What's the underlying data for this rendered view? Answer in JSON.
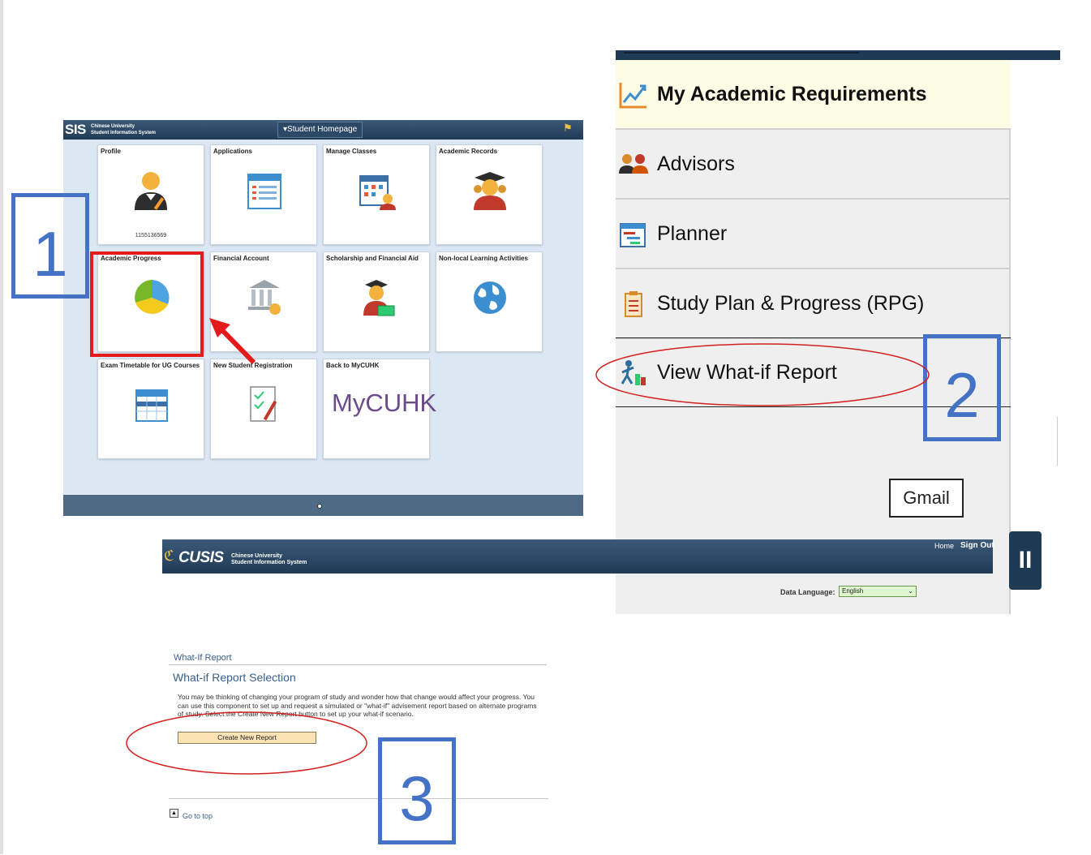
{
  "panel1": {
    "logo": "SIS",
    "logo_sub": "Chinese University\nStudent Information System",
    "nav_label": "Student Homepage",
    "tiles": [
      {
        "title": "Profile",
        "icon": "person-icon",
        "extra": "1155136569"
      },
      {
        "title": "Applications",
        "icon": "form-icon"
      },
      {
        "title": "Manage Classes",
        "icon": "calendar-student-icon"
      },
      {
        "title": "Academic Records",
        "icon": "graduate-icon"
      },
      {
        "title": "Academic Progress",
        "icon": "pie-chart-icon"
      },
      {
        "title": "Financial Account",
        "icon": "bank-icon"
      },
      {
        "title": "Scholarship and Financial Aid",
        "icon": "scholarship-icon"
      },
      {
        "title": "Non-local Learning Activities",
        "icon": "globe-icon"
      },
      {
        "title": "Exam Timetable for UG Courses",
        "icon": "calendar-icon"
      },
      {
        "title": "New Student Registration",
        "icon": "registration-icon"
      },
      {
        "title": "Back to MyCUHK",
        "icon": "mycuhk-logo"
      }
    ],
    "mycuhk_logo": "MyCUHK"
  },
  "steps": {
    "one": "1",
    "two": "2",
    "three": "3"
  },
  "panel2": {
    "menu": [
      {
        "label": "My Academic Requirements",
        "icon": "trend-chart-icon",
        "active": true
      },
      {
        "label": "Advisors",
        "icon": "people-icon"
      },
      {
        "label": "Planner",
        "icon": "planner-icon"
      },
      {
        "label": "Study Plan & Progress (RPG)",
        "icon": "clipboard-icon"
      },
      {
        "label": "View What-if Report",
        "icon": "whatif-icon"
      }
    ],
    "gmail": "Gmail"
  },
  "panel3": {
    "logo": "CUSIS",
    "logo_sub": "Chinese University\nStudent Information System",
    "home": "Home",
    "sign_out": "Sign Out",
    "data_language_label": "Data Language:",
    "data_language_value": "English",
    "breadcrumb": "What-If Report",
    "title": "What-if Report Selection",
    "description": "You may be thinking of changing your program of study and wonder how that change would affect your progress. You can use this component to set up and request a simulated or \"what-if\" advisement report based on alternate programs of study. Select the Create New Report button to set up your what-if scenario.",
    "create_button": "Create New Report",
    "go_to_top": "Go to top"
  },
  "colors": {
    "accent_blue": "#4472c4",
    "highlight_red": "#e31b1b",
    "header_navy": "#1f3a55"
  }
}
